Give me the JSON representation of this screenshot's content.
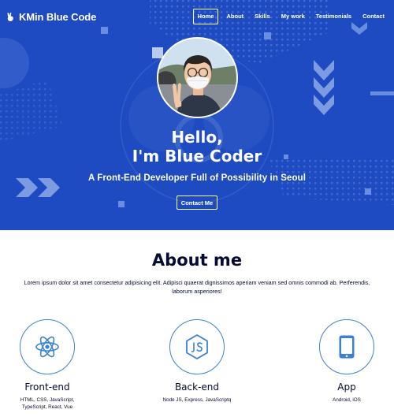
{
  "brand": {
    "title": "KMin Blue Code",
    "icon": "hand-peace-icon"
  },
  "nav": {
    "items": [
      {
        "label": "Home",
        "active": true
      },
      {
        "label": "About",
        "active": false
      },
      {
        "label": "Skills",
        "active": false
      },
      {
        "label": "My work",
        "active": false
      },
      {
        "label": "Testimonials",
        "active": false
      },
      {
        "label": "Contact",
        "active": false
      }
    ]
  },
  "hero": {
    "greeting_line1": "Hello,",
    "greeting_line2": "I'm Blue Coder",
    "subtitle": "A Front-End Developer Full of Possibility in Seoul",
    "contact_button": "Contact Me",
    "avatar_icon": "profile-photo"
  },
  "about": {
    "title": "About me",
    "description": "Lorem ipsum dolor sit amet consectetur adipisicing elit. Adipisci quaerat dignissimos aperiam veniam sed omnis commodi ab. Perferendis, laborum asperiores!",
    "skills": [
      {
        "title": "Front-end",
        "description": "HTML, CSS, JavaScript, TypeScript, React, Vue",
        "icon": "react-atom-icon"
      },
      {
        "title": "Back-end",
        "description": "Node JS, Express, JavaScriptq",
        "icon": "nodejs-icon"
      },
      {
        "title": "App",
        "description": "Android, iOS",
        "icon": "mobile-phone-icon"
      }
    ]
  },
  "colors": {
    "hero_background": "#1e4bc1",
    "accent": "#3b82d6",
    "text_dark": "#050a30",
    "white": "#ffffff"
  }
}
